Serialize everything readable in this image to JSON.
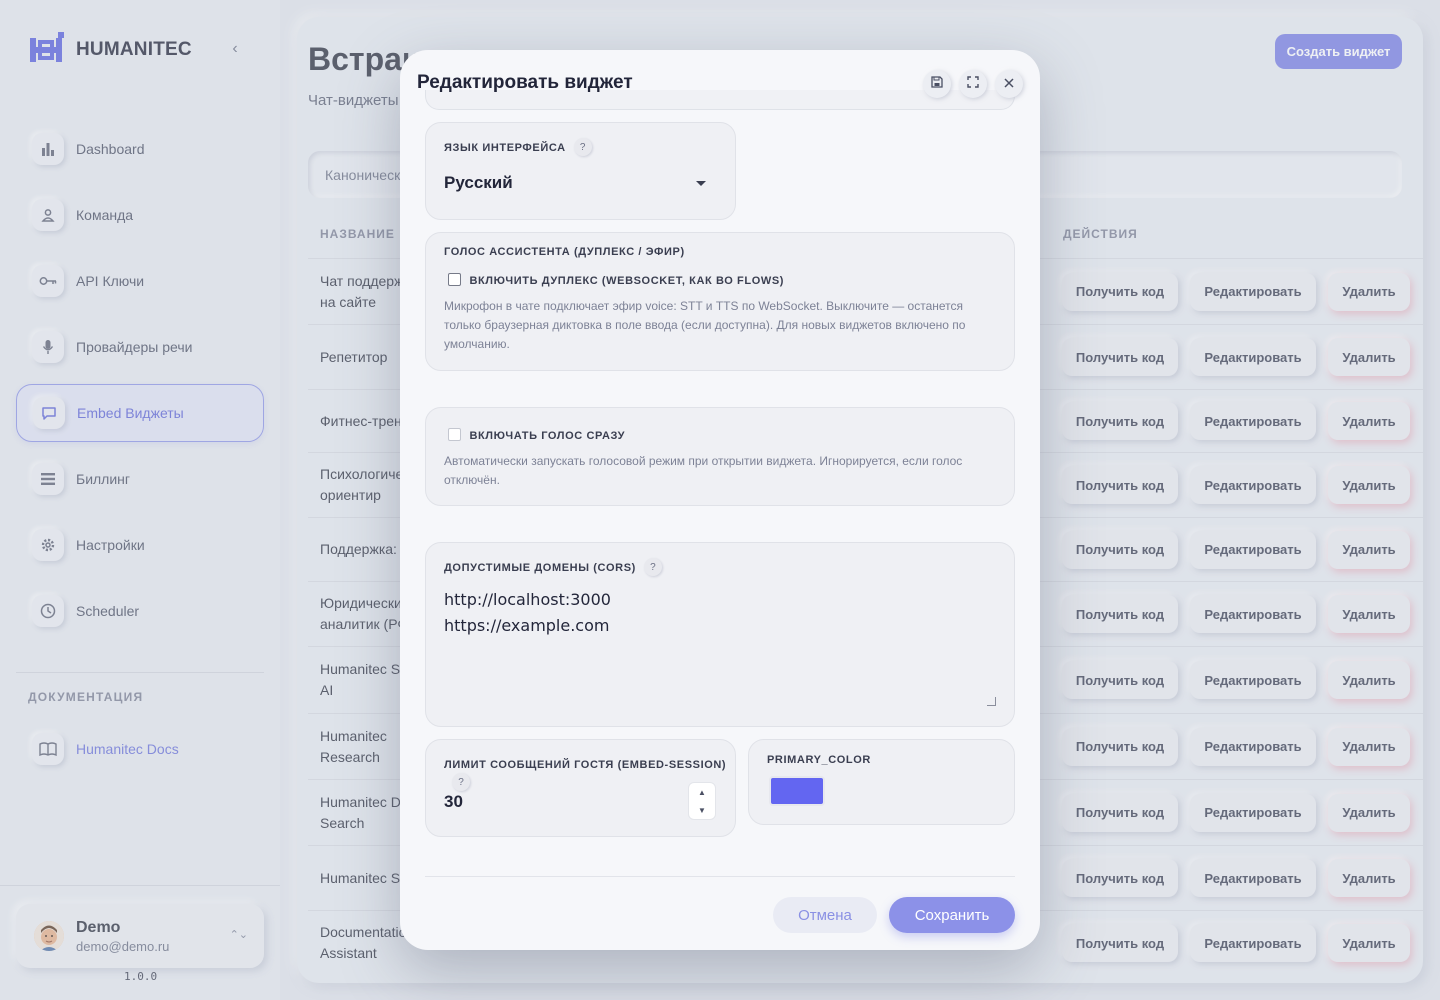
{
  "brand": {
    "name": "HUMANITEC",
    "accent": "#6366f1"
  },
  "sidebar": {
    "items": [
      {
        "label": "Dashboard",
        "icon": "bar-chart-icon"
      },
      {
        "label": "Команда",
        "icon": "user-icon"
      },
      {
        "label": "API Ключи",
        "icon": "key-icon"
      },
      {
        "label": "Провайдеры речи",
        "icon": "microphone-icon"
      },
      {
        "label": "Embed Виджеты",
        "icon": "chat-bubble-icon",
        "active": true
      },
      {
        "label": "Биллинг",
        "icon": "list-icon"
      },
      {
        "label": "Настройки",
        "icon": "gear-icon"
      },
      {
        "label": "Scheduler",
        "icon": "clock-icon"
      }
    ],
    "docs_heading": "ДОКУМЕНТАЦИЯ",
    "docs_link": {
      "label": "Humanitec Docs",
      "icon": "book-icon"
    },
    "user": {
      "name": "Demo",
      "email": "demo@demo.ru"
    },
    "version": "1.0.0"
  },
  "main": {
    "title": "Встраиваемые виджеты",
    "subtitle": "Чат-виджеты",
    "create_button": "Создать виджет",
    "search_placeholder": "Каноническ",
    "columns": {
      "name": "НАЗВАНИЕ",
      "actions": "ДЕЙСТВИЯ"
    },
    "row_actions": {
      "code": "Получить код",
      "edit": "Редактировать",
      "delete": "Удалить"
    },
    "rows": [
      {
        "name": "Чат поддерж\nна сайте"
      },
      {
        "name": "Репетитор"
      },
      {
        "name": "Фитнес-трен"
      },
      {
        "name": "Психологиче\nориентир"
      },
      {
        "name": "Поддержка: д"
      },
      {
        "name": "Юридически\nаналитик (РФ"
      },
      {
        "name": "Humanitec So\nAI"
      },
      {
        "name": "Humanitec\nResearch"
      },
      {
        "name": "Humanitec De\nSearch"
      },
      {
        "name": "Humanitec Se"
      },
      {
        "name": "Documentatio\nAssistant"
      }
    ]
  },
  "modal": {
    "title": "Редактировать виджет",
    "language": {
      "label": "ЯЗЫК ИНТЕРФЕЙСА",
      "help": "?",
      "value": "Русский"
    },
    "voice": {
      "label": "ГОЛОС АССИСТЕНТА (ДУПЛЕКС / ЭФИР)",
      "duplex_checkbox": "ВКЛЮЧИТЬ ДУПЛЕКС (WEBSOCKET, КАК ВО FLOWS)",
      "duplex_checked": false,
      "duplex_hint": "Микрофон в чате подключает эфир voice: STT и TTS по WebSocket. Выключите — останется только браузерная диктовка в поле ввода (если доступна). Для новых виджетов включено по умолчанию."
    },
    "autovoice": {
      "checkbox": "ВКЛЮЧАТЬ ГОЛОС СРАЗУ",
      "checked": false,
      "hint": "Автоматически запускать голосовой режим при открытии виджета. Игнорируется, если голос отключён."
    },
    "cors": {
      "label": "ДОПУСТИМЫЕ ДОМЕНЫ (CORS)",
      "help": "?",
      "line1": "http://localhost:3000",
      "line2": "https://example.com"
    },
    "guest_limit": {
      "label": "ЛИМИТ СООБЩЕНИЙ ГОСТЯ (EMBED-SESSION)",
      "help": "?",
      "value": "30"
    },
    "primary_color": {
      "label": "PRIMARY_COLOR",
      "value": "#6366f1"
    },
    "cancel": "Отмена",
    "save": "Сохранить"
  }
}
